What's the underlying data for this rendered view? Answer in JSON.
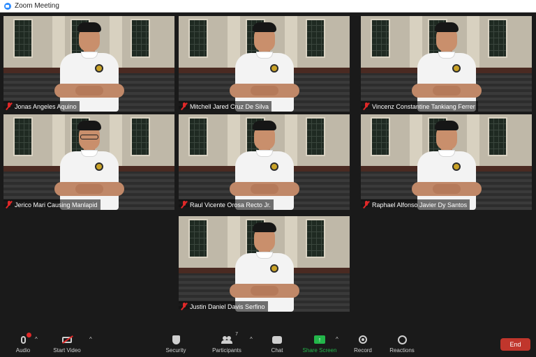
{
  "window": {
    "title": "Zoom Meeting"
  },
  "participants": [
    {
      "name": "Jonas Angeles Aquino",
      "muted": true,
      "glasses": false
    },
    {
      "name": "Mitchell Jared Cruz De Silva",
      "muted": true,
      "glasses": false
    },
    {
      "name": "Vincenz Constantine Tankiang Ferrer",
      "muted": true,
      "glasses": false
    },
    {
      "name": "Jerico Mari Causing Manlapid",
      "muted": true,
      "glasses": true
    },
    {
      "name": "Raul Vicente Orosa Recto Jr.",
      "muted": true,
      "glasses": false
    },
    {
      "name": "Raphael Alfonso Javier Dy Santos",
      "muted": true,
      "glasses": false
    },
    {
      "name": "Justin Daniel Davis Serfino",
      "muted": true,
      "glasses": false
    }
  ],
  "toolbar": {
    "audio_label": "Audio",
    "video_label": "Start Video",
    "security_label": "Security",
    "participants_label": "Participants",
    "participants_count": "7",
    "chat_label": "Chat",
    "share_label": "Share Screen",
    "record_label": "Record",
    "reactions_label": "Reactions",
    "end_label": "End"
  },
  "colors": {
    "accent_green": "#23b64a",
    "end_red": "#c0362c",
    "mute_red": "#e02828"
  },
  "icons": [
    "zoom-logo-icon",
    "mic-muted-icon",
    "microphone-icon",
    "camera-off-icon",
    "shield-icon",
    "participants-icon",
    "chat-bubble-icon",
    "share-screen-icon",
    "record-icon",
    "reactions-icon",
    "caret-up-icon"
  ]
}
